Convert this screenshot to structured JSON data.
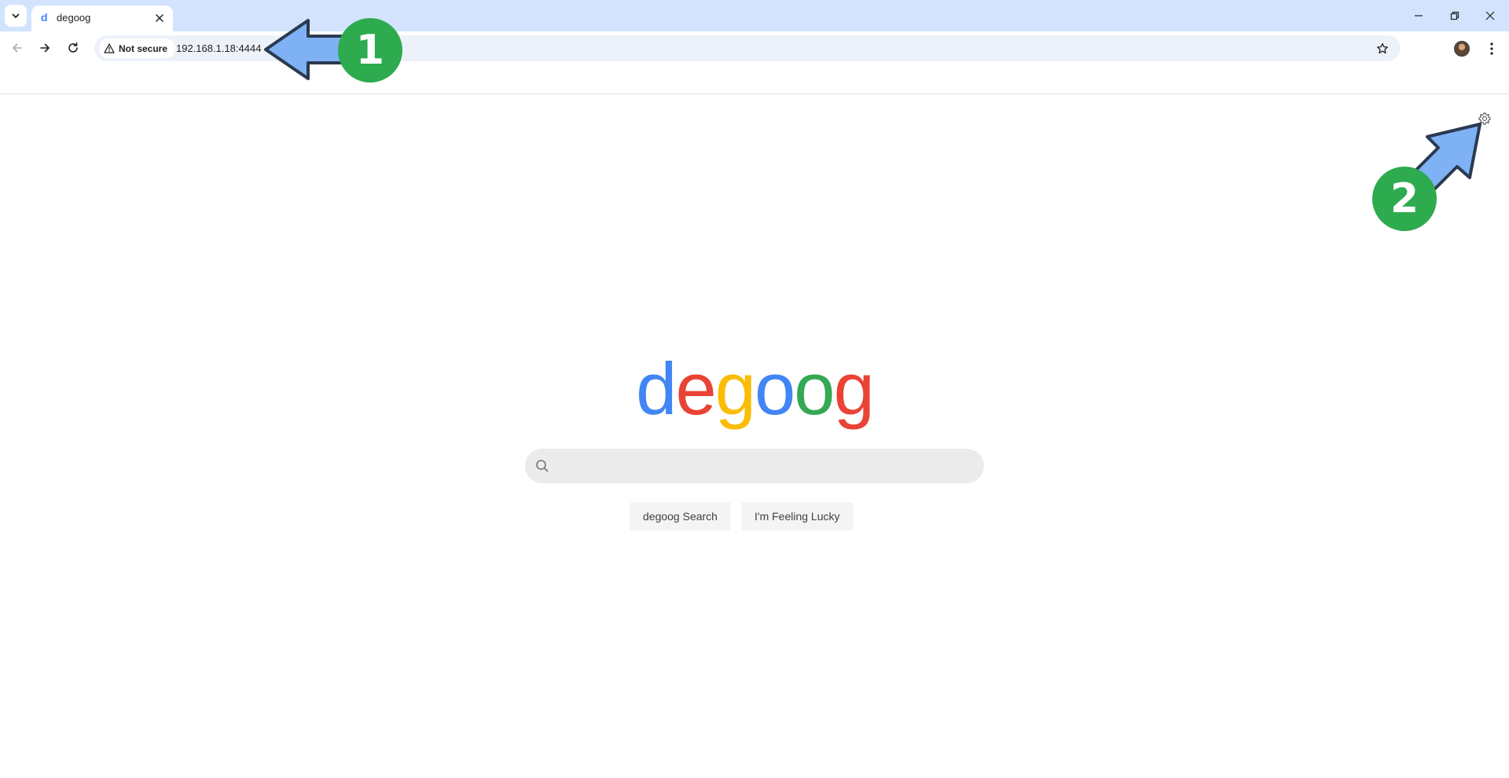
{
  "browser": {
    "tab": {
      "favicon": "d",
      "title": "degoog"
    },
    "omnibox": {
      "security_label": "Not secure",
      "url": "192.168.1.18:4444"
    },
    "icons": {
      "tab_search": "chevron-down-icon",
      "tab_close": "close-icon",
      "minimize": "minimize-icon",
      "restore": "restore-icon",
      "close_window": "close-icon",
      "back": "back-arrow-icon",
      "forward": "forward-arrow-icon",
      "reload": "reload-icon",
      "warning": "warning-icon",
      "bookmark": "star-icon",
      "menu": "kebab-menu-icon"
    }
  },
  "page": {
    "logo_letters": [
      {
        "char": "d",
        "color": "#4285f4"
      },
      {
        "char": "e",
        "color": "#ea4335"
      },
      {
        "char": "g",
        "color": "#fbbc05"
      },
      {
        "char": "o",
        "color": "#4285f4"
      },
      {
        "char": "o",
        "color": "#34a853"
      },
      {
        "char": "g",
        "color": "#ea4335"
      }
    ],
    "search": {
      "placeholder": "",
      "value": ""
    },
    "buttons": {
      "search": "degoog Search",
      "lucky": "I'm Feeling Lucky"
    },
    "settings_icon": "gear-icon"
  },
  "annotations": {
    "step1": "1",
    "step2": "2",
    "badge_color": "#2eaa4f",
    "arrow_color": "#7fb1f5"
  }
}
